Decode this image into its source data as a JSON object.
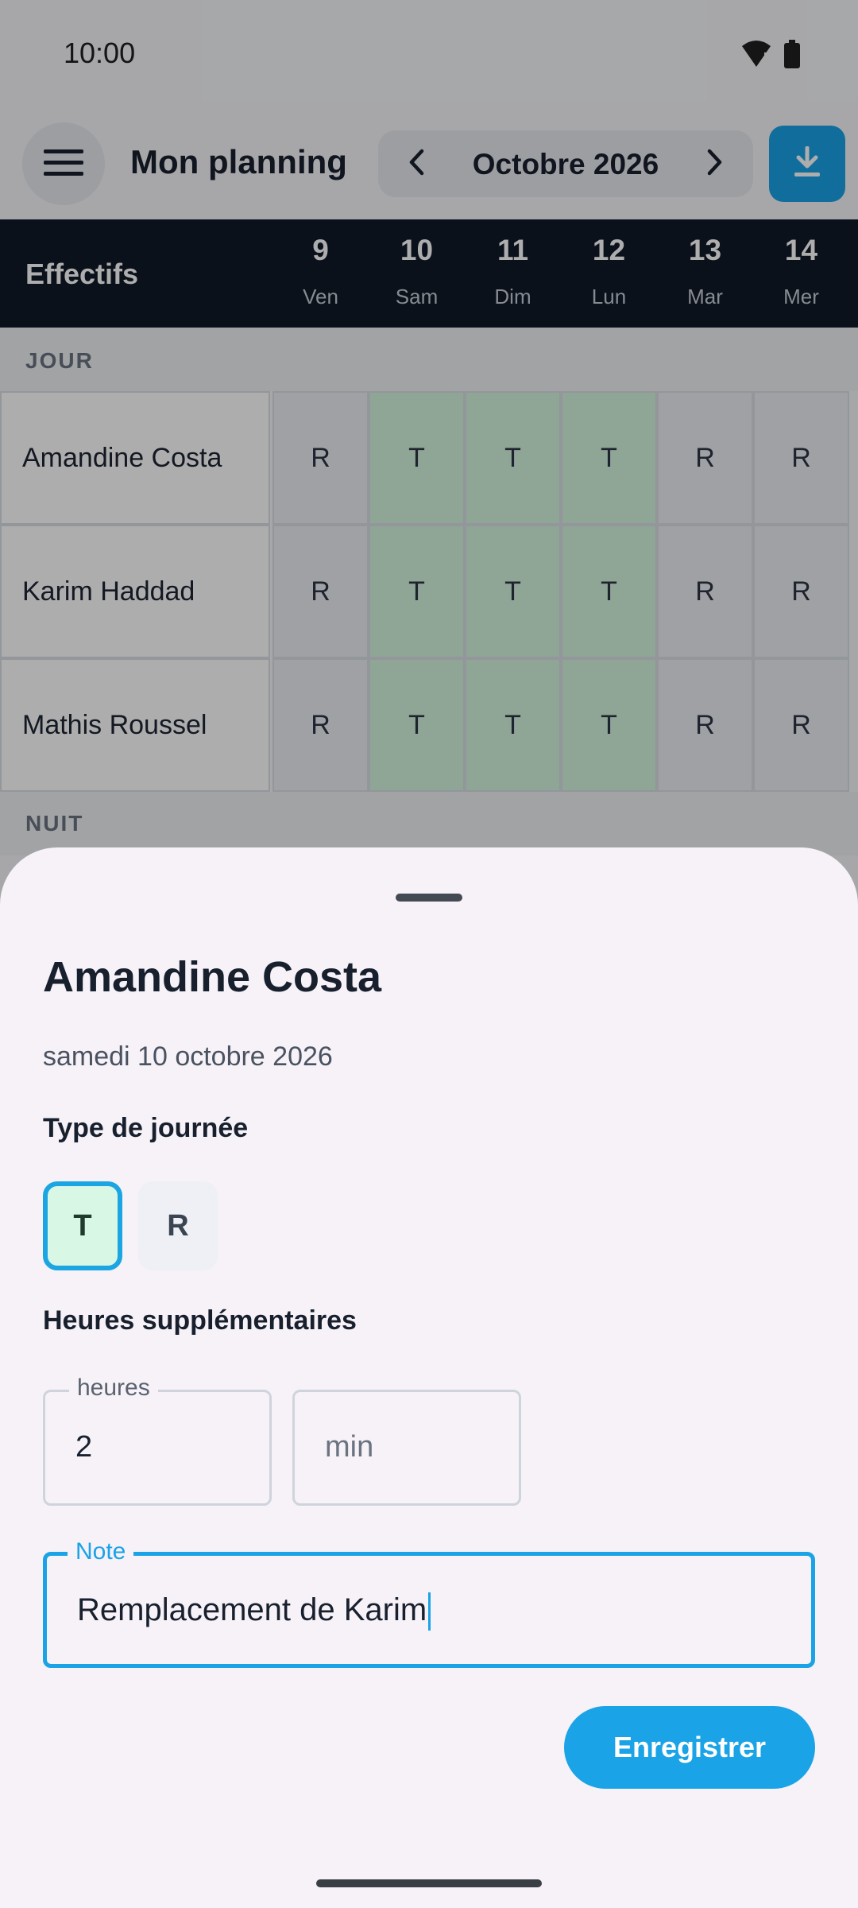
{
  "status_bar": {
    "time": "10:00"
  },
  "app_bar": {
    "title": "Mon planning",
    "month": "Octobre 2026"
  },
  "grid": {
    "header_label": "Effectifs",
    "days": [
      {
        "num": "9",
        "name": "Ven"
      },
      {
        "num": "10",
        "name": "Sam"
      },
      {
        "num": "11",
        "name": "Dim"
      },
      {
        "num": "12",
        "name": "Lun"
      },
      {
        "num": "13",
        "name": "Mar"
      },
      {
        "num": "14",
        "name": "Mer"
      }
    ],
    "sections": [
      {
        "label": "JOUR",
        "rows": [
          {
            "name": "Amandine Costa",
            "cells": [
              "R",
              "T",
              "T",
              "T",
              "R",
              "R"
            ]
          },
          {
            "name": "Karim Haddad",
            "cells": [
              "R",
              "T",
              "T",
              "T",
              "R",
              "R"
            ]
          },
          {
            "name": "Mathis Roussel",
            "cells": [
              "R",
              "T",
              "T",
              "T",
              "R",
              "R"
            ]
          }
        ]
      },
      {
        "label": "NUIT",
        "rows": []
      }
    ]
  },
  "sheet": {
    "title": "Amandine Costa",
    "date": "samedi 10 octobre 2026",
    "day_type_label": "Type de journée",
    "day_type_options": [
      "T",
      "R"
    ],
    "day_type_selected": "T",
    "overtime_label": "Heures supplémentaires",
    "hours": {
      "label": "heures",
      "value": "2"
    },
    "minutes": {
      "placeholder": "min"
    },
    "note": {
      "label": "Note",
      "value": "Remplacement de Karim"
    },
    "save_label": "Enregistrer"
  },
  "colors": {
    "accent": "#1aa3e6",
    "header_bg": "#0f1a27",
    "work_cell": "#d3f3de",
    "rest_cell": "#eceef2"
  }
}
